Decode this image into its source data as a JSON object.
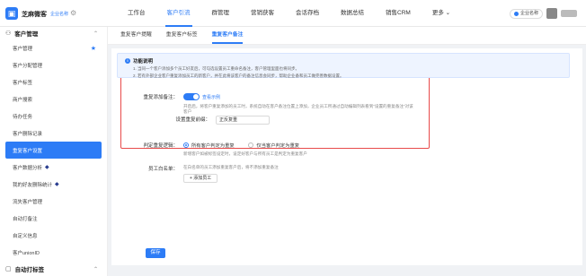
{
  "header": {
    "logo_glyph": "▣",
    "brand": "芝麻微客",
    "org": "企业名称",
    "settings_icon": "gear-icon",
    "nav": [
      {
        "label": "工作台"
      },
      {
        "label": "客户引流"
      },
      {
        "label": "群管理"
      },
      {
        "label": "营销获客"
      },
      {
        "label": "会话存档"
      },
      {
        "label": "数据总结"
      },
      {
        "label": "销售CRM"
      },
      {
        "label": "更多 ⌄"
      }
    ],
    "active_nav": "客户引流",
    "user_badge": "企业名称"
  },
  "sidebar": {
    "section1": "客户管理",
    "items": [
      {
        "label": "客户管理"
      },
      {
        "label": "客户分配管理"
      },
      {
        "label": "客户标签"
      },
      {
        "label": "商户搜索"
      },
      {
        "label": "待办任务"
      },
      {
        "label": "客户删除记录"
      },
      {
        "label": "重复客户设置"
      },
      {
        "label": "客户数据分析"
      },
      {
        "label": "我的好友删除统计"
      },
      {
        "label": "流失客户管理"
      },
      {
        "label": "自动打备注"
      },
      {
        "label": "自定义信息"
      },
      {
        "label": "客户unionID"
      }
    ],
    "active_item": "重复客户设置",
    "section2": "自动打标签"
  },
  "tabs": [
    {
      "label": "重复客户提醒"
    },
    {
      "label": "重复客户标签"
    },
    {
      "label": "重复客户备注"
    }
  ],
  "active_tab": "重复客户备注",
  "notice": {
    "title": "功能说明",
    "line1": "1. 当同一个客户添加多个员工好友后，可勾选设置员工重命名备注，客户管理里面也将同步。",
    "line2": "2. 若有外部企业客户重复添加员工的新客户，并在此将该客户的备注信息会同步，帮助企业备和员工做完善数据设置。"
  },
  "form": {
    "dup_note_label": "重复添加备注：",
    "toggle_text": "查看示例",
    "dup_note_help": "开启后，将客户重复添加的员工时，系统自动在客户备注位置上添加，企业员工所通过自动编辑列表看到“设置的重复备注”对该客户",
    "prefix_label": "设置重复前缀：",
    "prefix_value": "正反复重",
    "logic_label": "判定重复逻辑：",
    "opt1": "所有客户判定为重复",
    "opt2": "仅当客户判定为重复",
    "logic_help": "新增客户如被标签设定时，设定好客户与所有员工是判定为重复客户",
    "staff_label": "员工白名单：",
    "staff_help": "在白名单的员工添加重复客户后，将不添加重复备注",
    "add_staff": "+ 添加员工",
    "save": "保存"
  },
  "colors": {
    "accent": "#2d7cf6",
    "highlight_box": "#e84a4a"
  }
}
